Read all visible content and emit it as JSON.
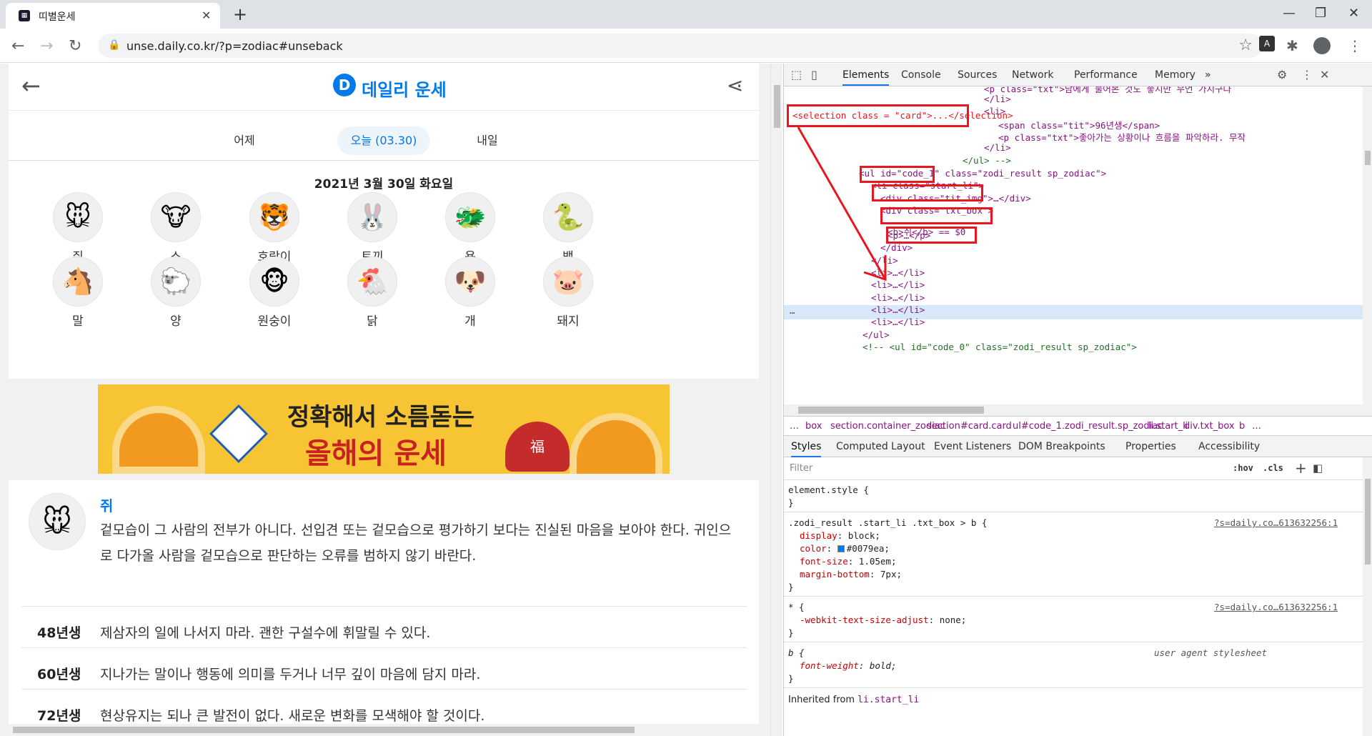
{
  "browser": {
    "tab_title": "띠별운세",
    "url": "unse.daily.co.kr/?p=zodiac#unseback"
  },
  "site": {
    "brand": "데일리 운세",
    "logo_letter": "D",
    "days": [
      "어제",
      "오늘 (03.30)",
      "내일"
    ],
    "date": "2021년 3월 30일 화요일",
    "zodiac": [
      {
        "name": "쥐",
        "glyph": "🐭"
      },
      {
        "name": "소",
        "glyph": "🐮"
      },
      {
        "name": "호랑이",
        "glyph": "🐯"
      },
      {
        "name": "토끼",
        "glyph": "🐰"
      },
      {
        "name": "용",
        "glyph": "🐲"
      },
      {
        "name": "뱀",
        "glyph": "🐍"
      },
      {
        "name": "말",
        "glyph": "🐴"
      },
      {
        "name": "양",
        "glyph": "🐑"
      },
      {
        "name": "원숭이",
        "glyph": "🐵"
      },
      {
        "name": "닭",
        "glyph": "🐔"
      },
      {
        "name": "개",
        "glyph": "🐶"
      },
      {
        "name": "돼지",
        "glyph": "🐷"
      }
    ],
    "banner": {
      "line1": "정확해서 소름돋는",
      "line2": "올해의 운세",
      "badge": "福"
    },
    "result": {
      "title": "쥐",
      "text": "겉모습이 그 사람의 전부가 아니다. 선입견 또는 겉모습으로 평가하기 보다는 진실된 마음을 보아야 한다. 귀인으로 다가올 사람을 겉모습으로 판단하는 오류를 범하지 않기 바란다.",
      "years": [
        {
          "year": "48년생",
          "text": "제삼자의 일에 나서지 마라. 괜한 구설수에 휘말릴 수 있다."
        },
        {
          "year": "60년생",
          "text": "지나가는 말이나 행동에 의미를 두거나 너무 깊이 마음에 담지 마라."
        },
        {
          "year": "72년생",
          "text": "현상유지는 되나 큰 발전이 없다. 새로운 변화를 모색해야 할 것이다."
        }
      ]
    }
  },
  "devtools": {
    "tabs": [
      "Elements",
      "Console",
      "Sources",
      "Network",
      "Performance",
      "Memory"
    ],
    "more": "»",
    "dom_lines": [
      "<p class=\"txt\">남에게 물어본 것도 좋지만 무언 가지구나",
      "</li>",
      "<li>",
      "<span class=\"tit\">96년생</span>",
      "<p class=\"txt\">좋아가는 상황이나 흐름을 파악하라. 무작",
      "</li>",
      "</ul> -->",
      "<ul id=\"code_1\" class=\"zodi_result sp_zodiac\">",
      "<li class=\"start_li\">",
      "<div class=\"tit_img\">…</div>",
      "<div class=\"txt_box\">",
      "<b>쥐</b> == $0",
      "<p>…</p>",
      "</div>",
      "</li>",
      "<li>…</li>",
      "<li>…</li>",
      "<li>…</li>",
      "<li>…</li>",
      "<li>…</li>",
      "</ul>",
      "<!-- <ul id=\"code_0\" class=\"zodi_result sp_zodiac\">"
    ],
    "annotation": "<selection class = \"card\">...</selection>",
    "breadcrumbs": [
      "…",
      "box",
      "section.container_zodiac",
      "section#card.card",
      "ul#code_1.zodi_result.sp_zodiac",
      "li.start_li",
      "div.txt_box",
      "b",
      "…"
    ],
    "subtabs": [
      "Styles",
      "Computed",
      "Layout",
      "Event Listeners",
      "DOM Breakpoints",
      "Properties",
      "Accessibility"
    ],
    "filter_placeholder": "Filter",
    "hov": ":hov",
    "cls": ".cls",
    "styles": [
      {
        "selector": "element.style {",
        "close": "}"
      },
      {
        "selector": ".zodi_result .start_li .txt_box > b {",
        "source": "?s=daily.co…613632256:1",
        "props": [
          [
            "display",
            "block;"
          ],
          [
            "color",
            "#0079ea;"
          ],
          [
            "font-size",
            "1.05em;"
          ],
          [
            "margin-bottom",
            "7px;"
          ]
        ],
        "close": "}"
      },
      {
        "selector": "* {",
        "source": "?s=daily.co…613632256:1",
        "props": [
          [
            "-webkit-text-size-adjust",
            "none;"
          ]
        ],
        "close": "}"
      },
      {
        "selector": "b {",
        "source": "user agent stylesheet",
        "props": [
          [
            "font-weight",
            "bold;"
          ]
        ],
        "close": "}"
      }
    ],
    "inherited": "Inherited from",
    "inherited_sel": "li.start_li"
  },
  "colors": {
    "accent": "#0079ea",
    "annotation_red": "#e8161e"
  }
}
